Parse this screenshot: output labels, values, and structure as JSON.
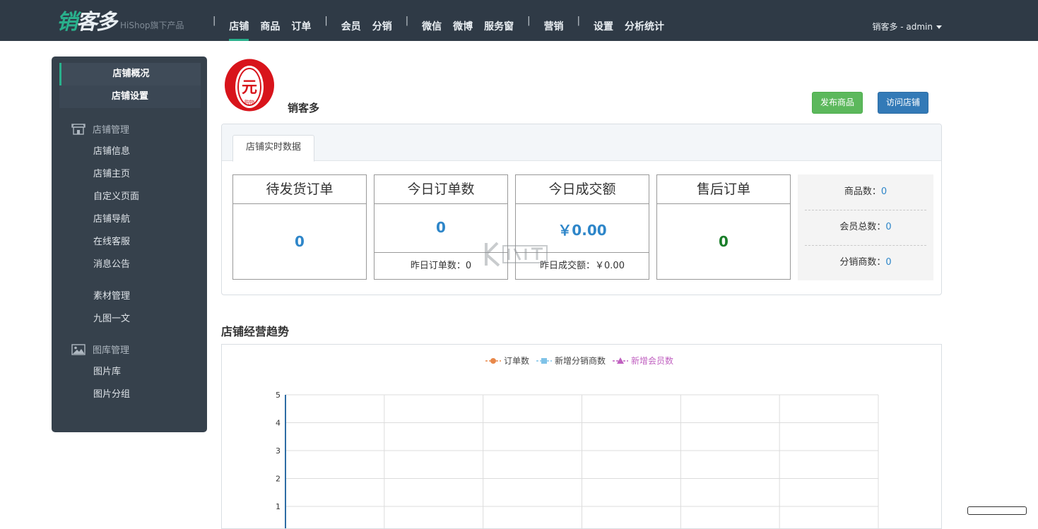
{
  "header": {
    "logo_text_1": "销",
    "logo_text_2": "客多",
    "logo_sub": "HiShop旗下产品",
    "nav": [
      {
        "label": "店铺",
        "active": true
      },
      {
        "label": "商品"
      },
      {
        "label": "订单"
      },
      {
        "label": "会员"
      },
      {
        "label": "分销"
      },
      {
        "label": "微信"
      },
      {
        "label": "微博"
      },
      {
        "label": "服务窗"
      },
      {
        "label": "营销"
      },
      {
        "label": "设置"
      },
      {
        "label": "分析统计"
      }
    ],
    "separator": "|",
    "user": "销客多 - admin"
  },
  "sidebar": {
    "tabs": [
      "店铺概况",
      "店铺设置"
    ],
    "groups": [
      {
        "label": "店铺管理",
        "icon": "store-icon",
        "items": [
          "店铺信息",
          "店铺主页",
          "自定义页面",
          "店铺导航",
          "在线客服",
          "消息公告"
        ]
      },
      {
        "label": "",
        "items": [
          "素材管理",
          "九图一文"
        ]
      },
      {
        "label": "图库管理",
        "icon": "image-icon",
        "items": [
          "图片库",
          "图片分组"
        ]
      }
    ]
  },
  "store": {
    "name": "销客多",
    "logo_char": "元",
    "logo_sub": "购物"
  },
  "actions": {
    "publish": "发布商品",
    "visit": "访问店铺"
  },
  "realtime": {
    "tab": "店铺实时数据",
    "pending_orders": {
      "title": "待发货订单",
      "value": "0"
    },
    "today_orders": {
      "title": "今日订单数",
      "value": "0",
      "foot": "昨日订单数：0"
    },
    "today_sales": {
      "title": "今日成交额",
      "value": "￥0.00",
      "foot": "昨日成交额：￥0.00"
    },
    "after_sales": {
      "title": "售后订单",
      "value": "0"
    },
    "side": [
      {
        "label": "商品数：",
        "value": "0"
      },
      {
        "label": "会员总数：",
        "value": "0"
      },
      {
        "label": "分销商数：",
        "value": "0"
      }
    ]
  },
  "trend": {
    "title": "店铺经营趋势"
  },
  "chart_data": {
    "type": "line",
    "series": [
      {
        "name": "订单数",
        "color": "#e8884a",
        "values": []
      },
      {
        "name": "新增分销商数",
        "color": "#7fc3e8",
        "values": []
      },
      {
        "name": "新增会员数",
        "color": "#c060c0",
        "values": []
      }
    ],
    "y_ticks": [
      "5",
      "4",
      "3",
      "2",
      "1"
    ],
    "ylim": [
      0,
      5
    ],
    "grid": true
  },
  "colors": {
    "topbar": "#2f3a46",
    "sidebar": "#36414c",
    "accent": "#29b08c",
    "value_blue": "#2e86c9",
    "value_green": "#1a7e2a"
  }
}
